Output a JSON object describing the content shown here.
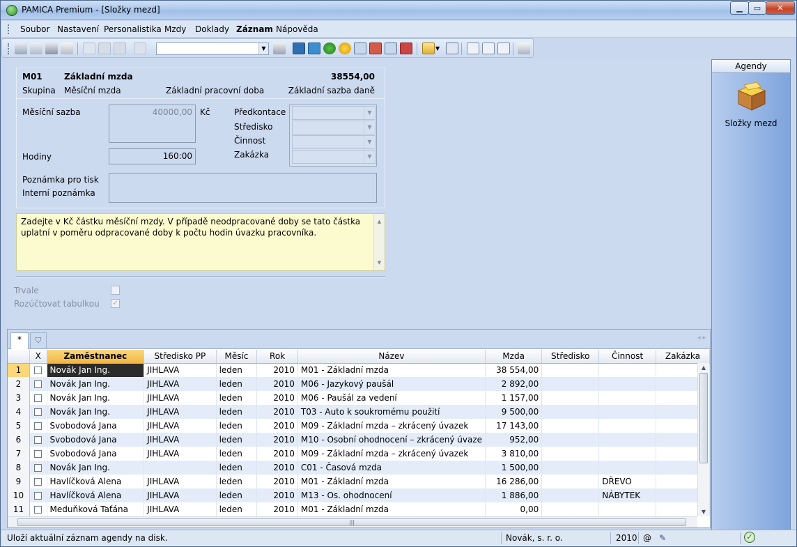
{
  "window": {
    "title": "PAMICA Premium - [Složky mezd]"
  },
  "menu": [
    "Soubor",
    "Nastavení",
    "Personalistika",
    "Mzdy",
    "Doklady",
    "Záznam",
    "Nápověda"
  ],
  "active_menu": "Záznam",
  "form": {
    "code": "M01",
    "name": "Základní mzda",
    "amount": "38554,00",
    "group_label": "Skupina",
    "group_value": "Měsíční mzda",
    "base_time_label": "Základní pracovní doba",
    "tax_base_label": "Základní sazba daně",
    "monthly_rate_label": "Měsíční sazba",
    "monthly_rate_value": "40000,00",
    "currency": "Kč",
    "hours_label": "Hodiny",
    "hours_value": "160:00",
    "predkontace_label": "Předkontace",
    "stredisko_label": "Středisko",
    "cinnost_label": "Činnost",
    "zakazka_label": "Zakázka",
    "print_note_label": "Poznámka pro tisk",
    "internal_note_label": "Interní poznámka",
    "help_text": "Zadejte v Kč částku měsíční mzdy. V případě neodpracované doby se tato částka uplatní v poměru odpracované doby k počtu hodin úvazku pracovníka.",
    "trvale_label": "Trvale",
    "rozuctovat_label": "Rozúčtovat tabulkou",
    "rozuctovat_checked": true
  },
  "agendy": {
    "header": "Agendy",
    "item_label": "Složky mezd"
  },
  "grid": {
    "tab_new": "*",
    "columns": [
      "X",
      "Zaměstnanec",
      "Středisko PP",
      "Měsíc",
      "Rok",
      "Název",
      "Mzda",
      "Středisko",
      "Činnost",
      "Zakázka"
    ],
    "rows": [
      {
        "n": "1",
        "emp": "Novák Jan Ing.",
        "spp": "JIHLAVA",
        "mes": "leden",
        "rok": "2010",
        "nazev": "M01 - Základní mzda",
        "mzda": "38 554,00",
        "str": "",
        "cin": "",
        "zak": ""
      },
      {
        "n": "2",
        "emp": "Novák Jan Ing.",
        "spp": "JIHLAVA",
        "mes": "leden",
        "rok": "2010",
        "nazev": "M06 - Jazykový paušál",
        "mzda": "2 892,00",
        "str": "",
        "cin": "",
        "zak": ""
      },
      {
        "n": "3",
        "emp": "Novák Jan Ing.",
        "spp": "JIHLAVA",
        "mes": "leden",
        "rok": "2010",
        "nazev": "M06 - Paušál za vedení",
        "mzda": "1 157,00",
        "str": "",
        "cin": "",
        "zak": ""
      },
      {
        "n": "4",
        "emp": "Novák Jan Ing.",
        "spp": "JIHLAVA",
        "mes": "leden",
        "rok": "2010",
        "nazev": "T03 - Auto k soukromému použití",
        "mzda": "9 500,00",
        "str": "",
        "cin": "",
        "zak": ""
      },
      {
        "n": "5",
        "emp": "Svobodová Jana",
        "spp": "JIHLAVA",
        "mes": "leden",
        "rok": "2010",
        "nazev": "M09 - Základní mzda – zkrácený úvazek",
        "mzda": "17 143,00",
        "str": "",
        "cin": "",
        "zak": ""
      },
      {
        "n": "6",
        "emp": "Svobodová Jana",
        "spp": "JIHLAVA",
        "mes": "leden",
        "rok": "2010",
        "nazev": "M10 - Osobní ohodnocení – zkrácený úvaze",
        "mzda": "952,00",
        "str": "",
        "cin": "",
        "zak": ""
      },
      {
        "n": "7",
        "emp": "Svobodová Jana",
        "spp": "JIHLAVA",
        "mes": "leden",
        "rok": "2010",
        "nazev": "M09 - Základní mzda – zkrácený úvazek",
        "mzda": "3 810,00",
        "str": "",
        "cin": "",
        "zak": ""
      },
      {
        "n": "8",
        "emp": "Novák Jan Ing.",
        "spp": "",
        "mes": "leden",
        "rok": "2010",
        "nazev": "C01 - Časová mzda",
        "mzda": "1 500,00",
        "str": "",
        "cin": "",
        "zak": ""
      },
      {
        "n": "9",
        "emp": "Havlíčková Alena",
        "spp": "JIHLAVA",
        "mes": "leden",
        "rok": "2010",
        "nazev": "M01 - Základní mzda",
        "mzda": "16 286,00",
        "str": "",
        "cin": "DŘEVO",
        "zak": ""
      },
      {
        "n": "10",
        "emp": "Havlíčková Alena",
        "spp": "JIHLAVA",
        "mes": "leden",
        "rok": "2010",
        "nazev": "M13 - Os. ohodnocení",
        "mzda": "1 886,00",
        "str": "",
        "cin": "NÁBYTEK",
        "zak": ""
      },
      {
        "n": "11",
        "emp": "Meduňková Taťána",
        "spp": "JIHLAVA",
        "mes": "leden",
        "rok": "2010",
        "nazev": "M01 - Základní mzda",
        "mzda": "0,00",
        "str": "",
        "cin": "",
        "zak": ""
      }
    ]
  },
  "status": {
    "message": "Uloží aktuální záznam agendy na disk.",
    "company": "Novák, s. r. o.",
    "year": "2010",
    "at": "@"
  }
}
